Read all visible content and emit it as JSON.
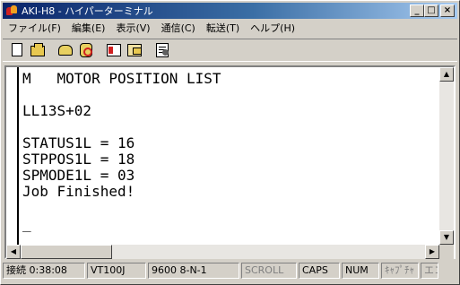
{
  "window": {
    "title": "AKI-H8 - ハイパーターミナル",
    "buttons": {
      "minimize": "_",
      "maximize": "□",
      "close": "×"
    }
  },
  "menu": [
    {
      "label": "ファイル(F)"
    },
    {
      "label": "編集(E)"
    },
    {
      "label": "表示(V)"
    },
    {
      "label": "通信(C)"
    },
    {
      "label": "転送(T)"
    },
    {
      "label": "ヘルプ(H)"
    }
  ],
  "toolbar": [
    {
      "icon": "new-file-icon"
    },
    {
      "icon": "open-folder-icon"
    },
    {
      "icon": "phone-connect-icon"
    },
    {
      "icon": "disconnect-icon"
    },
    {
      "icon": "send-file-icon"
    },
    {
      "icon": "receive-file-icon"
    },
    {
      "icon": "properties-icon"
    }
  ],
  "terminal": {
    "lines": [
      "M   MOTOR POSITION LIST",
      "",
      "LL13S+02",
      "",
      "STATUS1L = 16",
      "STPPOS1L = 18",
      "SPMODE1L = 03",
      "Job Finished!"
    ],
    "cursor": "_"
  },
  "statusbar": {
    "connected": "接続 0:38:08",
    "emulation": "VT100J",
    "port": "9600 8-N-1",
    "scroll": "SCROLL",
    "caps": "CAPS",
    "num": "NUM",
    "capture": "ｷｬﾌﾟﾁｬ",
    "echo": "エコー"
  }
}
